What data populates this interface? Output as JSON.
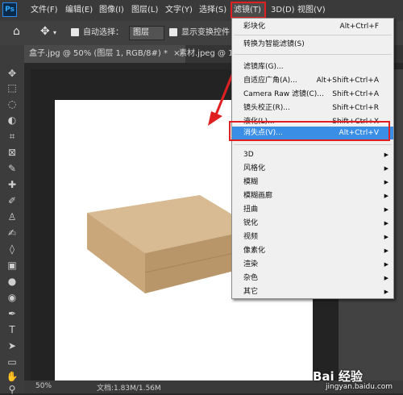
{
  "app": {
    "logo": "Ps"
  },
  "menubar": {
    "items": [
      "文件(F)",
      "编辑(E)",
      "图像(I)",
      "图层(L)",
      "文字(Y)",
      "选择(S)",
      "滤镜(T)",
      "3D(D)",
      "视图(V)"
    ],
    "active_item": "滤镜(T)"
  },
  "options_bar": {
    "auto_select_label": "自动选择：",
    "auto_select_value": "图层",
    "show_transform_label": "显示变换控件"
  },
  "tabs": [
    {
      "label": "盒子.jpg @ 50% (图层 1, RGB/8#) *",
      "close": "×"
    },
    {
      "label": "素材.jpeg @ 16..."
    }
  ],
  "statusbar": {
    "zoom": "50%",
    "doc": "文档:1.83M/1.56M"
  },
  "filter_menu": {
    "items": [
      {
        "label": "彩块化",
        "shortcut": "Alt+Ctrl+F"
      },
      {
        "separator": true
      },
      {
        "label": "转换为智能滤镜(S)",
        "shortcut": ""
      },
      {
        "separator": true
      },
      {
        "label": "滤镜库(G)...",
        "shortcut": ""
      },
      {
        "label": "自适应广角(A)...",
        "shortcut": "Alt+Shift+Ctrl+A"
      },
      {
        "label": "Camera Raw 滤镜(C)...",
        "shortcut": "Shift+Ctrl+A"
      },
      {
        "label": "镜头校正(R)...",
        "shortcut": "Shift+Ctrl+R"
      },
      {
        "label": "液化(L)...",
        "shortcut": "Shift+Ctrl+X"
      },
      {
        "label": "消失点(V)...",
        "shortcut": "Alt+Ctrl+V",
        "highlighted": true
      },
      {
        "separator": true
      },
      {
        "label": "3D",
        "submenu": true
      },
      {
        "label": "风格化",
        "submenu": true
      },
      {
        "label": "模糊",
        "submenu": true
      },
      {
        "label": "模糊画廊",
        "submenu": true
      },
      {
        "label": "扭曲",
        "submenu": true
      },
      {
        "label": "锐化",
        "submenu": true
      },
      {
        "label": "视频",
        "submenu": true
      },
      {
        "label": "像素化",
        "submenu": true
      },
      {
        "label": "渲染",
        "submenu": true
      },
      {
        "label": "杂色",
        "submenu": true
      },
      {
        "label": "其它",
        "submenu": true
      }
    ]
  },
  "watermark": {
    "brand": "Bai 经验",
    "url": "jingyan.baidu.com"
  },
  "colors": {
    "highlight": "#3a8ee6",
    "annotation_red": "#e02020"
  }
}
